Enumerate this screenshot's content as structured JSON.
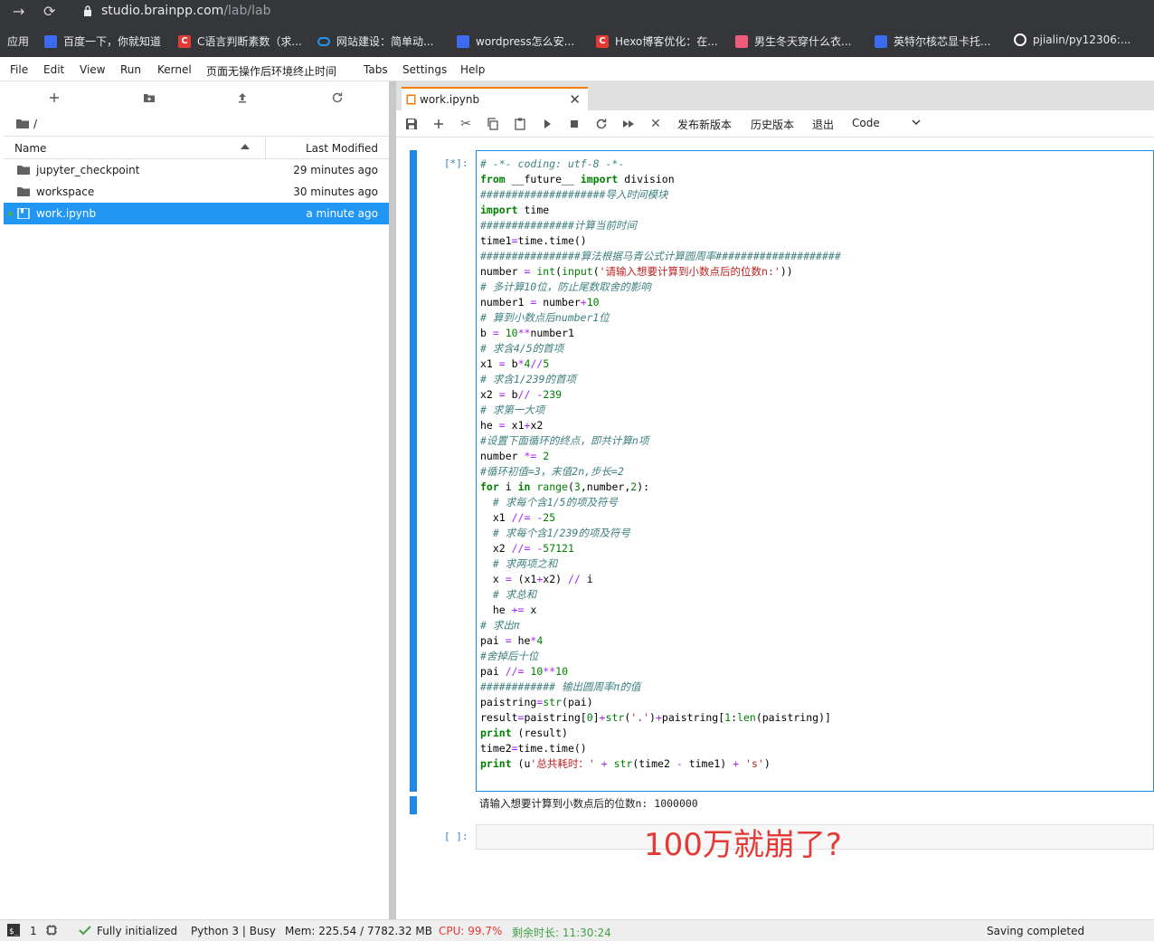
{
  "browser": {
    "url_host": "studio.brainpp.com",
    "url_path": "/lab/lab",
    "bookmarks": [
      {
        "label": "应用",
        "icon": "apps-grid-icon",
        "color": ""
      },
      {
        "label": "百度一下，你就知道",
        "icon": "baidu-paw-icon",
        "color": "#3b6cf0"
      },
      {
        "label": "C语言判断素数（求...",
        "icon": "csdn-c-icon",
        "color": "#e53935"
      },
      {
        "label": "网站建设：简单动...",
        "icon": "cloud-icon",
        "color": "#2196f3"
      },
      {
        "label": "wordpress怎么安...",
        "icon": "baidu-paw-icon",
        "color": "#3b6cf0"
      },
      {
        "label": "Hexo博客优化：在...",
        "icon": "csdn-c-icon",
        "color": "#e53935"
      },
      {
        "label": "男生冬天穿什么衣...",
        "icon": "pencil-icon",
        "color": "#ef5a7a"
      },
      {
        "label": "英特尔核芯显卡托...",
        "icon": "baidu-paw-icon",
        "color": "#3b6cf0"
      },
      {
        "label": "pjialin/py12306:...",
        "icon": "github-icon",
        "color": "#ffffff"
      }
    ]
  },
  "menu": [
    "File",
    "Edit",
    "View",
    "Run",
    "Kernel",
    "页面无操作后环境终止时间",
    "Tabs",
    "Settings",
    "Help"
  ],
  "filebrowser": {
    "breadcrumb": "/",
    "col_name": "Name",
    "col_modified": "Last Modified",
    "files": [
      {
        "name": "jupyter_checkpoint",
        "modified": "29 minutes ago",
        "type": "folder"
      },
      {
        "name": "workspace",
        "modified": "30 minutes ago",
        "type": "folder"
      },
      {
        "name": "work.ipynb",
        "modified": "a minute ago",
        "type": "notebook"
      }
    ]
  },
  "notebook": {
    "tab_title": "work.ipynb",
    "toolbar": {
      "publish": "发布新版本",
      "history": "历史版本",
      "exit": "退出",
      "cell_type": "Code"
    },
    "cell1_prompt": "[*]:",
    "code": [
      "# -*- coding: utf-8 -*-",
      "from __future__ import division",
      "####################导入时间模块",
      "import time",
      "###############计算当前时间",
      "time1=time.time()",
      "################算法根据马青公式计算圆周率####################",
      "number = int(input('请输入想要计算到小数点后的位数n:'))",
      "# 多计算10位，防止尾数取舍的影响",
      "number1 = number+10",
      "# 算到小数点后number1位",
      "b = 10**number1",
      "# 求含4/5的首项",
      "x1 = b*4//5",
      "# 求含1/239的首项",
      "x2 = b// -239",
      "# 求第一大项",
      "he = x1+x2",
      "#设置下面循环的终点，即共计算n项",
      "number *= 2",
      "#循环初值=3，末值2n,步长=2",
      "for i in range(3,number,2):",
      "  # 求每个含1/5的项及符号",
      "  x1 //= -25",
      "  # 求每个含1/239的项及符号",
      "  x2 //= -57121",
      "  # 求两项之和",
      "  x = (x1+x2) // i",
      "  # 求总和",
      "  he += x",
      "# 求出π",
      "pai = he*4",
      "#舍掉后十位",
      "pai //= 10**10",
      "############ 输出圆周率π的值",
      "paistring=str(pai)",
      "result=paistring[0]+str('.')+paistring[1:len(paistring)]",
      "print (result)",
      "time2=time.time()",
      "print (u'总共耗时：' + str(time2 - time1) + 's')"
    ],
    "output": "请输入想要计算到小数点后的位数n: 1000000",
    "cell2_prompt": "[ ]:",
    "annotation": "100万就崩了?"
  },
  "status": {
    "terminals": "1",
    "init": "Fully initialized",
    "kernel": "Python 3 | Busy",
    "mem": "Mem: 225.54 / 7782.32 MB",
    "cpu": "CPU: 99.7%",
    "remaining": "剩余时长: 11:30:24",
    "saving": "Saving completed"
  }
}
